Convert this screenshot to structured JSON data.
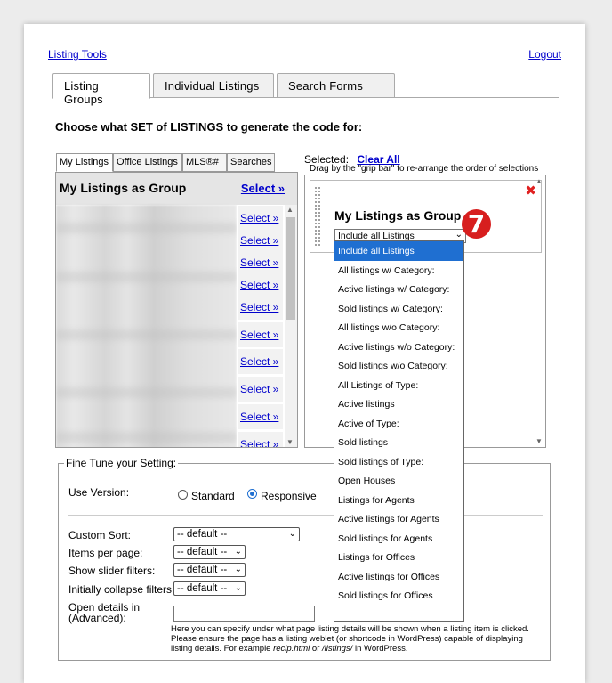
{
  "header": {
    "listing_tools": "Listing Tools",
    "logout": "Logout"
  },
  "main_tabs": [
    "Listing Groups",
    "Individual Listings",
    "Search Forms"
  ],
  "section_title": "Choose what SET of LISTINGS to generate the code for:",
  "left_panel": {
    "tabs": [
      "My Listings",
      "Office Listings",
      "MLS®#",
      "Searches"
    ],
    "title": "My Listings as Group",
    "select_all": "Select »",
    "select_label": "Select »",
    "row_count": 10
  },
  "right_panel": {
    "selected_label": "Selected:",
    "clear_all": "Clear All",
    "drag_hint": "Drag by the \"grip bar\" to re-arrange the order of selections",
    "group_title": "My Listings as Group",
    "select_value": "Include all Listings",
    "badge": "7"
  },
  "dropdown_options": [
    "Include all Listings",
    "All listings w/ Category:",
    "Active listings w/ Category:",
    "Sold listings w/ Category:",
    "All listings w/o Category:",
    "Active listings w/o Category:",
    "Sold listings w/o Category:",
    "All Listings of Type:",
    "Active listings",
    "Active of Type:",
    "Sold listings",
    "Sold listings of Type:",
    "Open Houses",
    "Listings for Agents",
    "Active listings for Agents",
    "Sold listings for Agents",
    "Listings for Offices",
    "Active listings for Offices",
    "Sold listings for Offices"
  ],
  "fine_tune": {
    "legend": "Fine Tune your Setting:",
    "use_version_label": "Use Version:",
    "standard": "Standard",
    "responsive": "Responsive",
    "custom_sort_label": "Custom Sort:",
    "custom_sort_value": "-- default --",
    "items_per_page_label": "Items per page:",
    "items_per_page_value": "-- default --",
    "slider_label": "Show slider filters:",
    "slider_value": "-- default --",
    "collapse_label": "Initially collapse filters:",
    "collapse_value": "-- default --",
    "open_details_label_1": "Open details in",
    "open_details_label_2": "(Advanced):",
    "help_1": "Here you can specify under what page listing details will be shown when a listing item is clicked. Please ensure the page has a listing weblet (or shortcode in WordPress) capable of displaying listing details. For example ",
    "help_example_1": "recip.html",
    "help_or": " or ",
    "help_example_2": "/listings/",
    "help_end": " in WordPress."
  },
  "colors": {
    "link": "#0000cc",
    "highlight": "#1f6fd1",
    "badge": "#d71e1e",
    "close": "#e02020"
  }
}
